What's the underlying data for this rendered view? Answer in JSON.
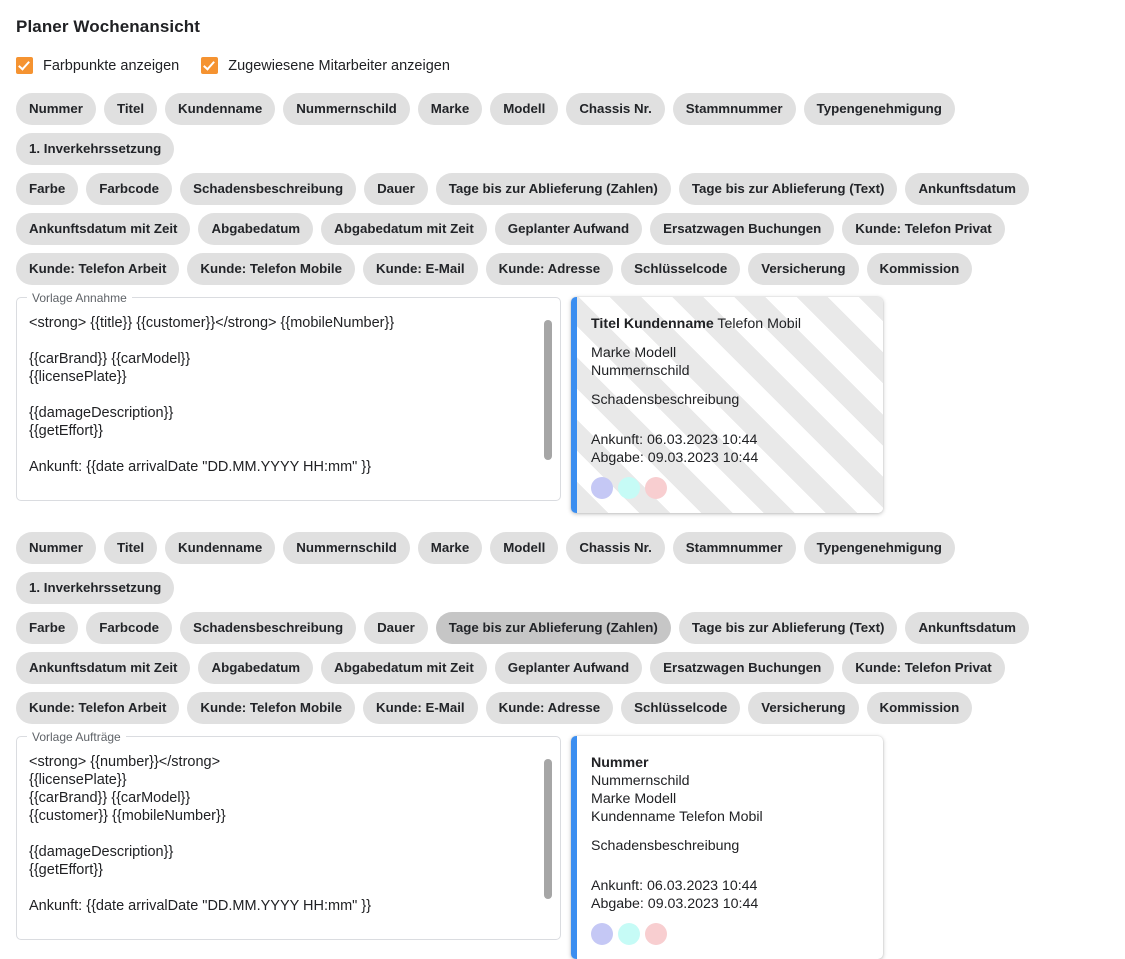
{
  "header": {
    "title": "Planer Wochenansicht"
  },
  "options": [
    {
      "label": "Farbpunkte anzeigen",
      "checked": true,
      "name": "show-color-dots"
    },
    {
      "label": "Zugewiesene Mitarbeiter anzeigen",
      "checked": true,
      "name": "show-assigned-employees"
    }
  ],
  "colors": {
    "checkbox": "#F59331",
    "chip": "#e0e0e0",
    "chip_selected": "#c6c6c6",
    "card_accent": "#3b8ef0",
    "stripe": "#e9e9e9",
    "dot_purple": "#c5c8f5",
    "dot_cyan": "#c6fbf6",
    "dot_pink": "#f8ced0"
  },
  "section_annahme": {
    "chips": [
      [
        "Nummer",
        "Titel",
        "Kundenname",
        "Nummernschild",
        "Marke",
        "Modell",
        "Chassis Nr.",
        "Stammnummer",
        "Typengenehmigung",
        "1. Inverkehrssetzung"
      ],
      [
        "Farbe",
        "Farbcode",
        "Schadensbeschreibung",
        "Dauer",
        "Tage bis zur Ablieferung (Zahlen)",
        "Tage bis zur Ablieferung (Text)",
        "Ankunftsdatum"
      ],
      [
        "Ankunftsdatum mit Zeit",
        "Abgabedatum",
        "Abgabedatum mit Zeit",
        "Geplanter Aufwand",
        "Ersatzwagen Buchungen",
        "Kunde: Telefon Privat"
      ],
      [
        "Kunde: Telefon Arbeit",
        "Kunde: Telefon Mobile",
        "Kunde: E-Mail",
        "Kunde: Adresse",
        "Schlüsselcode",
        "Versicherung",
        "Kommission"
      ]
    ],
    "selected_chip": null,
    "field_label": "Vorlage Annahme",
    "field_value": "<strong> {{title}} {{customer}}</strong> {{mobileNumber}}\n\n{{carBrand}} {{carModel}}\n{{licensePlate}}\n\n{{damageDescription}}\n{{getEffort}}\n\nAnkunft: {{date arrivalDate \"DD.MM.YYYY HH:mm\" }}",
    "card": {
      "striped": true,
      "head_bold": "Titel Kundenname",
      "head_rest": " Telefon Mobil",
      "lines": [
        "Marke Modell",
        "Nummernschild"
      ],
      "description": "Schadensbeschreibung",
      "arrival": "Ankunft: 06.03.2023 10:44",
      "departure": "Abgabe: 09.03.2023 10:44"
    }
  },
  "section_auftraege": {
    "chips": [
      [
        "Nummer",
        "Titel",
        "Kundenname",
        "Nummernschild",
        "Marke",
        "Modell",
        "Chassis Nr.",
        "Stammnummer",
        "Typengenehmigung",
        "1. Inverkehrssetzung"
      ],
      [
        "Farbe",
        "Farbcode",
        "Schadensbeschreibung",
        "Dauer",
        "Tage bis zur Ablieferung (Zahlen)",
        "Tage bis zur Ablieferung (Text)",
        "Ankunftsdatum"
      ],
      [
        "Ankunftsdatum mit Zeit",
        "Abgabedatum",
        "Abgabedatum mit Zeit",
        "Geplanter Aufwand",
        "Ersatzwagen Buchungen",
        "Kunde: Telefon Privat"
      ],
      [
        "Kunde: Telefon Arbeit",
        "Kunde: Telefon Mobile",
        "Kunde: E-Mail",
        "Kunde: Adresse",
        "Schlüsselcode",
        "Versicherung",
        "Kommission"
      ]
    ],
    "selected_chip": "Tage bis zur Ablieferung (Zahlen)",
    "field_label": "Vorlage Aufträge",
    "field_value": "<strong> {{number}}</strong>\n{{licensePlate}}\n{{carBrand}} {{carModel}}\n{{customer}} {{mobileNumber}}\n\n{{damageDescription}}\n{{getEffort}}\n\nAnkunft: {{date arrivalDate \"DD.MM.YYYY HH:mm\" }}",
    "card": {
      "striped": false,
      "head_bold": "Nummer",
      "head_rest": "",
      "lines": [
        "Nummernschild",
        "Marke Modell",
        "Kundenname Telefon Mobil"
      ],
      "description": "Schadensbeschreibung",
      "arrival": "Ankunft: 06.03.2023 10:44",
      "departure": "Abgabe: 09.03.2023 10:44"
    }
  }
}
